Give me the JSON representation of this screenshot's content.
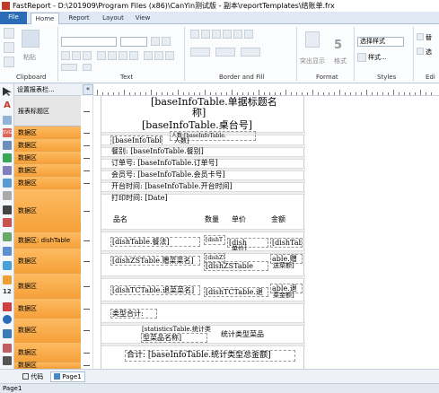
{
  "window": {
    "title": "FastReport - D:\\201909\\Program Files (x86)\\CanYin测试版 - 副本\\reportTemplates\\结账单.frx"
  },
  "tabs": {
    "file": "File",
    "home": "Home",
    "report": "Report",
    "layout": "Layout",
    "view": "View"
  },
  "ribbon": {
    "clipboard": {
      "label": "Clipboard",
      "paste": "粘贴"
    },
    "text": {
      "label": "Text"
    },
    "border_fill": {
      "label": "Border and Fill"
    },
    "format": {
      "label": "Format",
      "highlight": "突出显示",
      "format": "格式"
    },
    "styles": {
      "label": "Styles",
      "style_select": "选择样式",
      "style_btn": "样式..."
    },
    "edit": {
      "label": "Edi",
      "replace": "替",
      "select": "选"
    }
  },
  "bandheader": "设置报表栏...",
  "bands": [
    {
      "label": "报表标题区",
      "kind": "gray"
    },
    {
      "label": "数据区",
      "kind": "orange"
    },
    {
      "label": "数据区",
      "kind": "orange"
    },
    {
      "label": "数据区",
      "kind": "orange"
    },
    {
      "label": "数据区",
      "kind": "orange"
    },
    {
      "label": "数据区",
      "kind": "orange"
    },
    {
      "label": "数据区",
      "kind": "orange"
    },
    {
      "label": "数据区: dishTable",
      "kind": "orange"
    },
    {
      "label": "数据区",
      "kind": "orange"
    },
    {
      "label": "数据区",
      "kind": "orange"
    },
    {
      "label": "数据区",
      "kind": "orange"
    },
    {
      "label": "数据区",
      "kind": "orange"
    },
    {
      "label": "数据区",
      "kind": "orange"
    },
    {
      "label": "数据区",
      "kind": "orange"
    }
  ],
  "fields": {
    "title1": "[baseInfoTable.单据标题名",
    "title2": "称]",
    "title3": "[baseInfoTable.桌台号]",
    "f_base": "[baseInfoTable.",
    "f_base2": "人数]",
    "f_base_top": "人数:[baseInfoTable.",
    "canbie": "餐别: [baseInfoTable.餐别]",
    "orderno": "订单号: [baseInfoTable.订单号]",
    "member": "会员号: [baseInfoTable.会员卡号]",
    "opentime": "开台时间: [baseInfoTable.开台时间]",
    "printtime": "打印时间: [Date]",
    "col_name": "品名",
    "col_qty": "数量",
    "col_price": "单价",
    "col_amount": "金额",
    "dish_name": "[dishTable.餐法]",
    "dish_qty": "[dishT",
    "dish_price": "[dish",
    "dish_price2": "单价]",
    "dish_amount": "[dishTable.金额]",
    "zs_name": "[dishZSTable.赠菜菜名]",
    "zs_qty": "[dishZST",
    "zs_price": "[dishZSTable",
    "zs_amount": "able.赠",
    "zs_amount2": "送菜额]",
    "tc_name": "[dishTCTable.退菜菜名]",
    "tc_qty": "[dishTCTable.退",
    "tc_amount": "able.退",
    "tc_amount2": "菜金额]",
    "leixing": "类型合计:",
    "tj_name1": "[statisticsTable.统计类",
    "tj_name2": "型菜品名称]",
    "tj_amount": "统计类型菜品",
    "total": "合计: [baseInfoTable.统计类型总金额]"
  },
  "pagetabs": {
    "code": "代码",
    "page1": "Page1"
  },
  "status": "Page1"
}
